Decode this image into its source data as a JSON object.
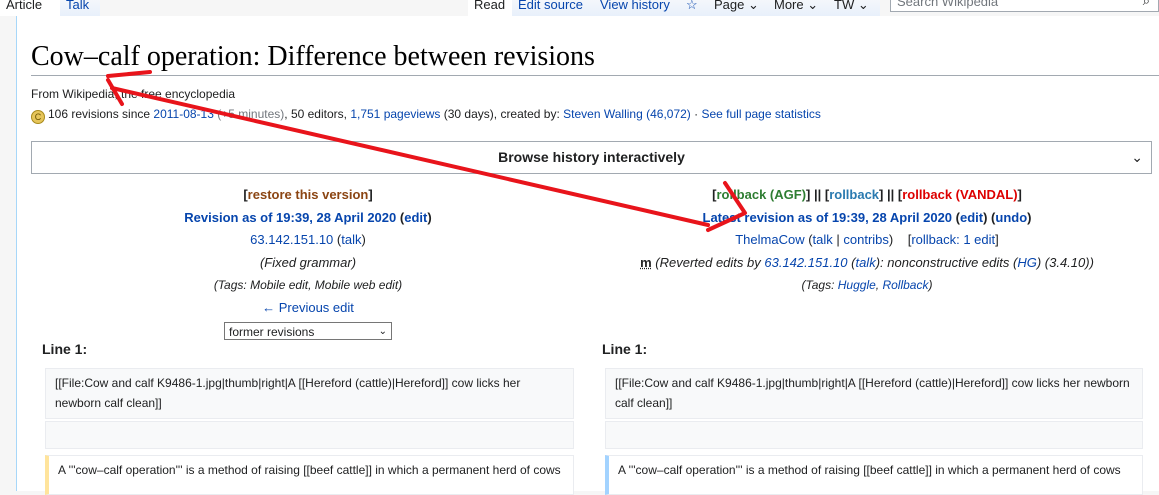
{
  "tabs": {
    "article": "Article",
    "talk": "Talk",
    "read": "Read",
    "edit_source": "Edit source",
    "view_history": "View history",
    "star": "☆",
    "page": "Page",
    "more": "More",
    "tw": "TW",
    "search_placeholder": "Search Wikipedia"
  },
  "title": "Cow–calf operation: Difference between revisions",
  "tagline": "From Wikipedia, the free encyclopedia",
  "stats": {
    "revisions": "106 revisions since",
    "since_date": "2011-08-13",
    "delta": "(+5 minutes)",
    "editors": ", 50 editors,",
    "pageviews": "1,751 pageviews",
    "days": "(30 days), created by:",
    "creator": "Steven Walling",
    "creator_count": "(46,072)",
    "sep": " · ",
    "full_stats": "See full page statistics"
  },
  "browse": {
    "label": "Browse history interactively",
    "chevron": "⌄"
  },
  "left": {
    "restore": "restore this version",
    "rev_title": "Revision as of 19:39, 28 April 2020",
    "edit": "edit",
    "user": "63.142.151.10",
    "talk": "talk",
    "summary": "(Fixed grammar)",
    "tags_prefix": "(Tags: Mobile edit, Mobile web edit)",
    "prev": "← Previous edit",
    "select_value": "former revisions"
  },
  "right": {
    "rb_agf": "rollback (AGF)",
    "rb": "rollback",
    "rb_vandal": "rollback (VANDAL)",
    "rev_title": "Latest revision as of 19:39, 28 April 2020",
    "edit": "edit",
    "undo": "undo",
    "user": "ThelmaCow",
    "talk": "talk",
    "contribs": "contribs",
    "rb_one": "rollback: 1 edit",
    "minor": "m",
    "summary_a": "(Reverted edits by ",
    "summary_user": "63.142.151.10",
    "summary_talk": "talk",
    "summary_b": "): nonconstructive edits (",
    "summary_hg": "HG",
    "summary_c": ") (3.4.10))",
    "tags_label": "(Tags: ",
    "tag1": "Huggle",
    "tag2": "Rollback",
    "tags_end": ")"
  },
  "diff": {
    "line_left": "Line 1:",
    "line_right": "Line 1:",
    "ctx1": "[[File:Cow and calf K9486-1.jpg|thumb|right|A [[Hereford (cattle)|Hereford]] cow licks her newborn calf clean]]",
    "changed_left": "A '''cow–calf operation''' is a method of raising [[beef cattle]] in which a permanent herd of cows",
    "changed_right": "A '''cow–calf operation''' is a method of raising [[beef cattle]] in which a permanent herd of cows"
  },
  "annotation_color": "#e8141b"
}
